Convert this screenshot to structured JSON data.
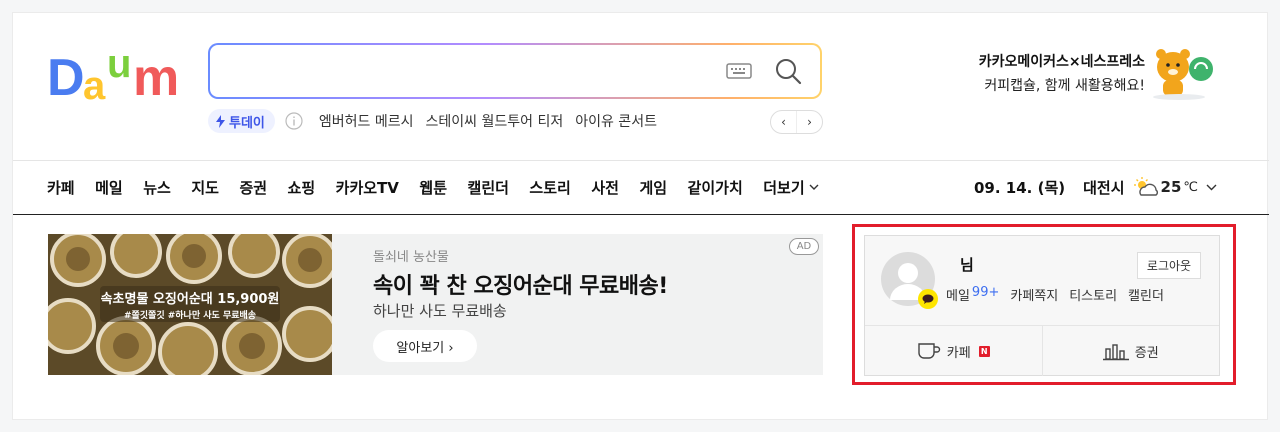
{
  "header": {
    "logo_text": "Daum",
    "search": {
      "value": "",
      "placeholder": ""
    },
    "today_label": "투데이",
    "issues": [
      "엠버허드 메르시",
      "스테이씨 월드투어 티저",
      "아이유 콘서트"
    ],
    "pager": {
      "prev": "‹",
      "next": "›"
    },
    "promo": {
      "title": "카카오메이커스×네스프레소",
      "subtitle": "커피캡슐, 함께 새활용해요!"
    }
  },
  "nav": {
    "items": [
      "카페",
      "메일",
      "뉴스",
      "지도",
      "증권",
      "쇼핑",
      "카카오TV",
      "웹툰",
      "캘린더",
      "스토리",
      "사전",
      "게임",
      "같이가치"
    ],
    "more_label": "더보기",
    "date": "09. 14. (목)",
    "city": "대전시",
    "temperature": "25",
    "temp_unit": "℃"
  },
  "banner": {
    "image_line1": "속초명물 오징어순대 15,900원",
    "image_line2": "#쫄깃쫄깃 #하나만 사도 무료배송",
    "seller": "돌쇠네 농산물",
    "title": "속이 꽉 찬 오징어순대 무료배송!",
    "subtitle": "하나만 사도 무료배송",
    "cta": "알아보기 ›",
    "ad_label": "AD"
  },
  "user_panel": {
    "username": "님",
    "logout_label": "로그아웃",
    "links": {
      "mail": "메일",
      "mail_count": "99+",
      "cafe_note": "카페쪽지",
      "tistory": "티스토리",
      "calendar": "캘린더"
    },
    "services": {
      "cafe": "카페",
      "cafe_new": "N",
      "stock": "증권"
    }
  },
  "colors": {
    "highlight": "#e21d2b",
    "accent": "#3d55e8",
    "link_blue": "#3d6ef0"
  }
}
